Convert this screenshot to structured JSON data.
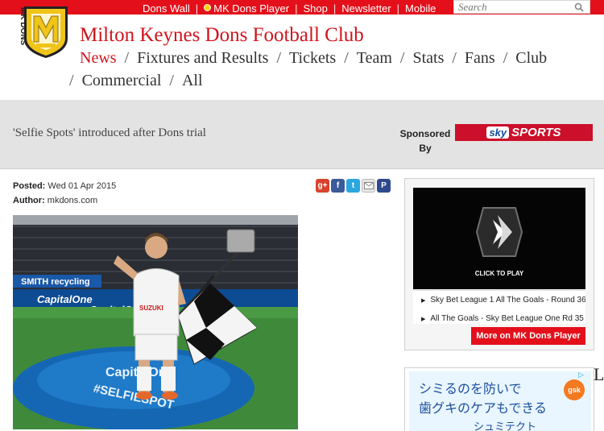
{
  "topnav": {
    "links": [
      "Dons Wall",
      "MK Dons Player",
      "Shop",
      "Newsletter",
      "Mobile"
    ]
  },
  "search": {
    "placeholder": "Search"
  },
  "logo": {
    "text": "MK DONS"
  },
  "site": {
    "title": "Milton Keynes Dons Football Club"
  },
  "mainnav": {
    "items": [
      "News",
      "Fixtures and Results",
      "Tickets",
      "Team",
      "Stats",
      "Fans",
      "Club",
      "Commercial",
      "All"
    ],
    "active": "News"
  },
  "article": {
    "title": "'Selfie Spots' introduced after Dons trial",
    "posted_label": "Posted:",
    "posted_value": "Wed 01 Apr 2015",
    "author_label": "Author:",
    "author_value": "mkdons.com",
    "photo": {
      "ad_board_1": "SMITH recycling",
      "ad_board_2": "CapitalOne",
      "ad_board_3": "CapitalOne",
      "shirt_sponsor": "SUZUKI",
      "platform_text_1": "CapitalOne",
      "platform_text_2": "#SELFIESPOT"
    }
  },
  "sponsor": {
    "label": "Sponsored By",
    "brand_1": "sky",
    "brand_2": "SPORTS"
  },
  "share": {
    "icons": [
      "google-plus-icon",
      "facebook-icon",
      "twitter-icon",
      "email-icon",
      "pinterest-icon"
    ]
  },
  "player": {
    "click_to_play": "CLICK TO PLAY",
    "playlist": [
      "Sky Bet League 1 All The Goals - Round 36",
      "All The Goals - Sky Bet League One Rd 35"
    ],
    "more_button": "More on MK Dons Player"
  },
  "ad": {
    "line1": "シミるのを防いで",
    "line2": "歯グキのケアもできる",
    "line3": "シュミテクト",
    "brand": "gsk",
    "edge_letter": "L"
  },
  "colors": {
    "brand_red": "#e3101b",
    "title_red": "#d0141c",
    "band_grey": "#e3e3e3"
  }
}
